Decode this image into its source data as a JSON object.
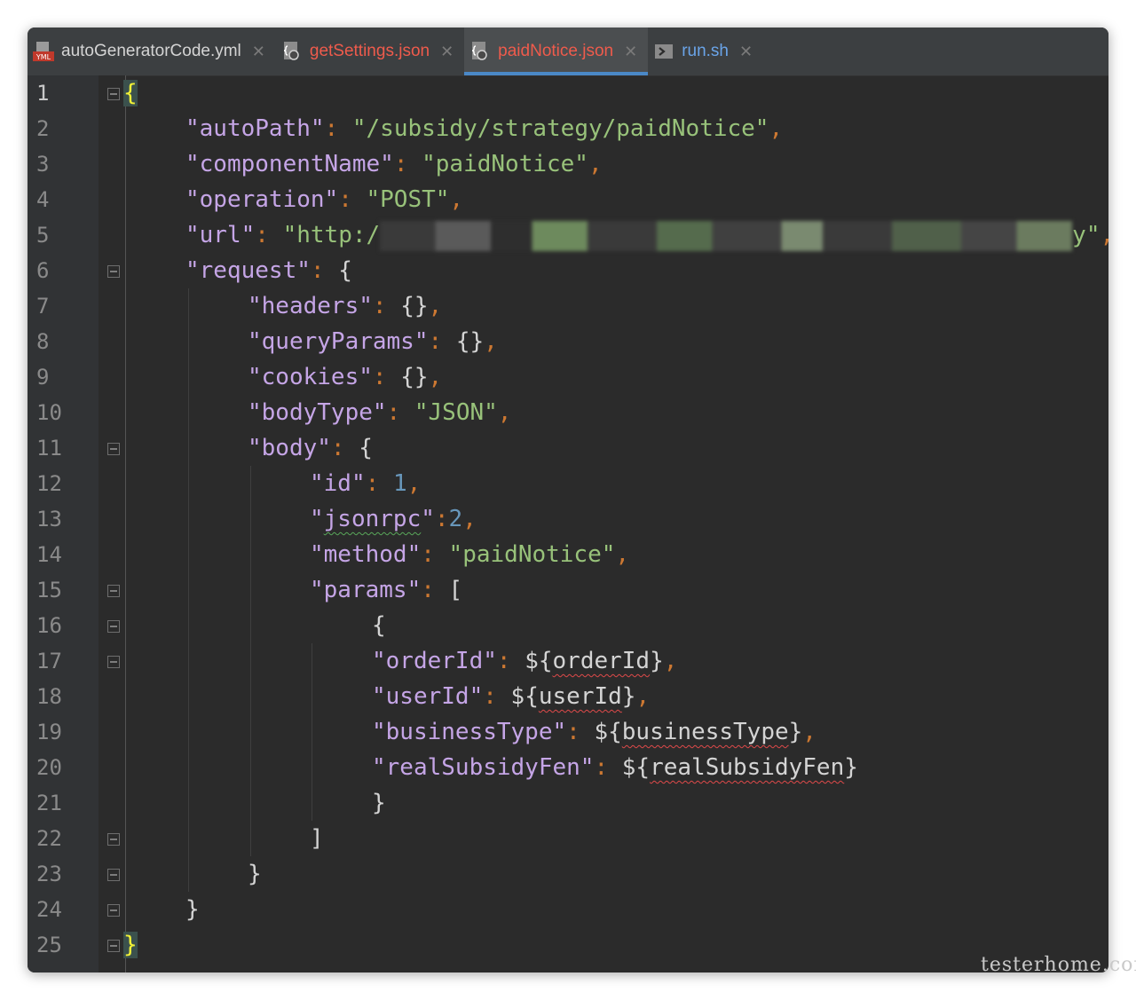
{
  "tabs": [
    {
      "label": "autoGeneratorCode.yml",
      "icon": "yaml-file-icon",
      "color": "#d4d4d4",
      "active": false
    },
    {
      "label": "getSettings.json",
      "icon": "json-file-icon",
      "color": "#ef5b4c",
      "active": false
    },
    {
      "label": "paidNotice.json",
      "icon": "json-file-icon",
      "color": "#ef5b4c",
      "active": true
    },
    {
      "label": "run.sh",
      "icon": "shell-script-icon",
      "color": "#6aa4e8",
      "active": false
    }
  ],
  "tab_close_glyph": "✕",
  "yml_badge": "YML",
  "line_numbers": [
    "1",
    "2",
    "3",
    "4",
    "5",
    "6",
    "7",
    "8",
    "9",
    "10",
    "11",
    "12",
    "13",
    "14",
    "15",
    "16",
    "17",
    "18",
    "19",
    "20",
    "21",
    "22",
    "23",
    "24",
    "25"
  ],
  "code": {
    "l1_brace": "{",
    "l2": {
      "key": "\"autoPath\"",
      "value": "\"/subsidy/strategy/paidNotice\""
    },
    "l3": {
      "key": "\"componentName\"",
      "value": "\"paidNotice\""
    },
    "l4": {
      "key": "\"operation\"",
      "value": "\"POST\""
    },
    "l5": {
      "key": "\"url\"",
      "value_visible": "\"http:/",
      "value_end": "y\""
    },
    "l6": {
      "key": "\"request\"",
      "brace": "{"
    },
    "l7": {
      "key": "\"headers\"",
      "value": "{}"
    },
    "l8": {
      "key": "\"queryParams\"",
      "value": "{}"
    },
    "l9": {
      "key": "\"cookies\"",
      "value": "{}"
    },
    "l10": {
      "key": "\"bodyType\"",
      "value": "\"JSON\""
    },
    "l11": {
      "key": "\"body\"",
      "brace": "{"
    },
    "l12": {
      "key": "\"id\"",
      "value": "1"
    },
    "l13": {
      "key_q1": "\"",
      "key_word": "jsonrpc",
      "key_q2": "\"",
      "value": "2"
    },
    "l14": {
      "key": "\"method\"",
      "value": "\"paidNotice\""
    },
    "l15": {
      "key": "\"params\"",
      "bracket": "["
    },
    "l16_brace": "{",
    "l17": {
      "key": "\"orderId\"",
      "var": "orderId"
    },
    "l18": {
      "key": "\"userId\"",
      "var": "userId"
    },
    "l19": {
      "key": "\"businessType\"",
      "var": "businessType"
    },
    "l20": {
      "key": "\"realSubsidyFen\"",
      "var": "realSubsidyFen"
    },
    "l21_brace": "}",
    "l22_bracket": "]",
    "l23_brace": "}",
    "l24_brace": "}",
    "l25_brace": "}"
  },
  "watermark": "testerhome.com",
  "colors": {
    "editor_bg": "#2b2b2b",
    "gutter_bg": "#313335",
    "key": "#c5a5e6",
    "string": "#98c27a",
    "number": "#6897bb",
    "punct": "#cc7832",
    "active_tab_underline": "#4a88c7"
  }
}
